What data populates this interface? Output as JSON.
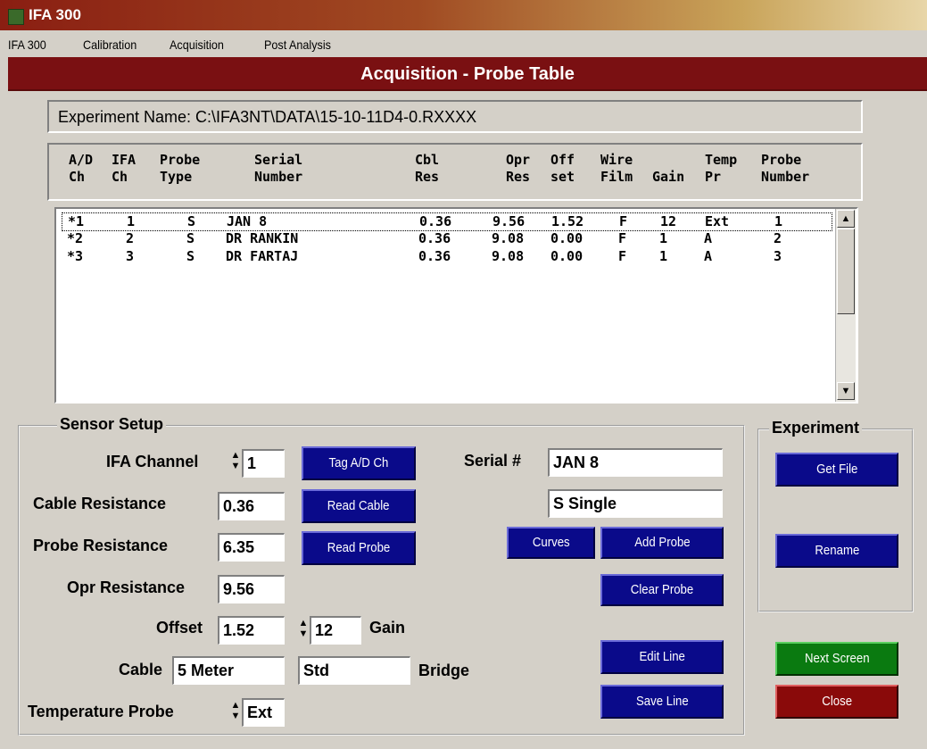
{
  "window": {
    "title": "IFA 300"
  },
  "menu": [
    "IFA 300",
    "Calibration",
    "Acquisition",
    "Post Analysis"
  ],
  "screen_title": "Acquisition - Probe Table",
  "experiment_name": "Experiment Name: C:\\IFA3NT\\DATA\\15-10-11D4-0.RXXXX",
  "table": {
    "headers": [
      [
        "A/D",
        "Ch"
      ],
      [
        "IFA",
        "Ch"
      ],
      [
        "Probe",
        "Type"
      ],
      [
        "Serial",
        "Number"
      ],
      [
        "Cbl",
        "Res"
      ],
      [
        "Opr",
        "Res"
      ],
      [
        "Off",
        "set"
      ],
      [
        "Wire",
        "Film"
      ],
      [
        "",
        "Gain"
      ],
      [
        "Temp",
        "Pr"
      ],
      [
        "Probe",
        "Number"
      ]
    ],
    "rows": [
      [
        "*1",
        "1",
        "S",
        "JAN 8",
        "0.36",
        "9.56",
        "1.52",
        "F",
        "12",
        "Ext",
        "1"
      ],
      [
        "*2",
        "2",
        "S",
        "DR RANKIN",
        "0.36",
        "9.08",
        "0.00",
        "F",
        "1",
        "A",
        "2"
      ],
      [
        "*3",
        "3",
        "S",
        "DR FARTAJ",
        "0.36",
        "9.08",
        "0.00",
        "F",
        "1",
        "A",
        "3"
      ]
    ]
  },
  "sensor_setup": {
    "title": "Sensor Setup",
    "ifa_channel_label": "IFA Channel",
    "ifa_channel": "1",
    "cable_res_label": "Cable Resistance",
    "cable_res": "0.36",
    "probe_res_label": "Probe Resistance",
    "probe_res": "6.35",
    "opr_res_label": "Opr Resistance",
    "opr_res": "9.56",
    "offset_label": "Offset",
    "offset": "1.52",
    "gain": "12",
    "gain_label": "Gain",
    "cable_label": "Cable",
    "cable": "5 Meter",
    "bridge": "Std",
    "bridge_label": "Bridge",
    "temp_probe_label": "Temperature Probe",
    "temp_probe": "Ext",
    "serial_label": "Serial #",
    "serial": "JAN 8",
    "probe_type": "S Single",
    "buttons": {
      "tag": "Tag A/D Ch",
      "read_cable": "Read Cable",
      "read_probe": "Read Probe",
      "curves": "Curves",
      "add_probe": "Add Probe",
      "clear_probe": "Clear Probe",
      "edit_line": "Edit Line",
      "save_line": "Save Line"
    }
  },
  "experiment": {
    "title": "Experiment",
    "get_file": "Get File",
    "rename": "Rename"
  },
  "next_screen": "Next Screen",
  "close": "Close"
}
